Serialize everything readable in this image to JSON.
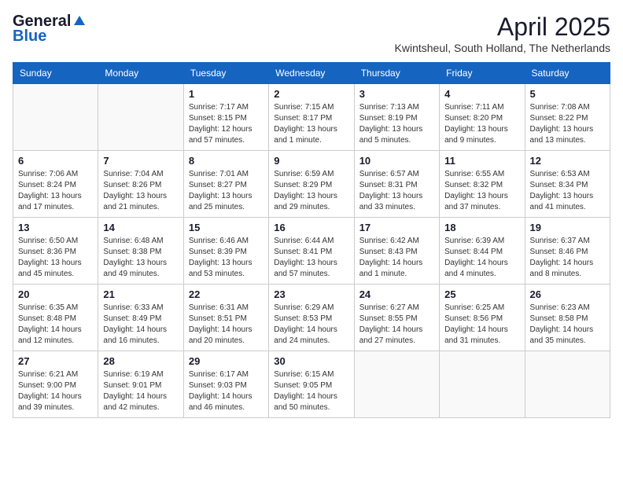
{
  "logo": {
    "general": "General",
    "blue": "Blue"
  },
  "title": "April 2025",
  "subtitle": "Kwintsheul, South Holland, The Netherlands",
  "days_of_week": [
    "Sunday",
    "Monday",
    "Tuesday",
    "Wednesday",
    "Thursday",
    "Friday",
    "Saturday"
  ],
  "weeks": [
    [
      {
        "day": "",
        "info": ""
      },
      {
        "day": "",
        "info": ""
      },
      {
        "day": "1",
        "info": "Sunrise: 7:17 AM\nSunset: 8:15 PM\nDaylight: 12 hours and 57 minutes."
      },
      {
        "day": "2",
        "info": "Sunrise: 7:15 AM\nSunset: 8:17 PM\nDaylight: 13 hours and 1 minute."
      },
      {
        "day": "3",
        "info": "Sunrise: 7:13 AM\nSunset: 8:19 PM\nDaylight: 13 hours and 5 minutes."
      },
      {
        "day": "4",
        "info": "Sunrise: 7:11 AM\nSunset: 8:20 PM\nDaylight: 13 hours and 9 minutes."
      },
      {
        "day": "5",
        "info": "Sunrise: 7:08 AM\nSunset: 8:22 PM\nDaylight: 13 hours and 13 minutes."
      }
    ],
    [
      {
        "day": "6",
        "info": "Sunrise: 7:06 AM\nSunset: 8:24 PM\nDaylight: 13 hours and 17 minutes."
      },
      {
        "day": "7",
        "info": "Sunrise: 7:04 AM\nSunset: 8:26 PM\nDaylight: 13 hours and 21 minutes."
      },
      {
        "day": "8",
        "info": "Sunrise: 7:01 AM\nSunset: 8:27 PM\nDaylight: 13 hours and 25 minutes."
      },
      {
        "day": "9",
        "info": "Sunrise: 6:59 AM\nSunset: 8:29 PM\nDaylight: 13 hours and 29 minutes."
      },
      {
        "day": "10",
        "info": "Sunrise: 6:57 AM\nSunset: 8:31 PM\nDaylight: 13 hours and 33 minutes."
      },
      {
        "day": "11",
        "info": "Sunrise: 6:55 AM\nSunset: 8:32 PM\nDaylight: 13 hours and 37 minutes."
      },
      {
        "day": "12",
        "info": "Sunrise: 6:53 AM\nSunset: 8:34 PM\nDaylight: 13 hours and 41 minutes."
      }
    ],
    [
      {
        "day": "13",
        "info": "Sunrise: 6:50 AM\nSunset: 8:36 PM\nDaylight: 13 hours and 45 minutes."
      },
      {
        "day": "14",
        "info": "Sunrise: 6:48 AM\nSunset: 8:38 PM\nDaylight: 13 hours and 49 minutes."
      },
      {
        "day": "15",
        "info": "Sunrise: 6:46 AM\nSunset: 8:39 PM\nDaylight: 13 hours and 53 minutes."
      },
      {
        "day": "16",
        "info": "Sunrise: 6:44 AM\nSunset: 8:41 PM\nDaylight: 13 hours and 57 minutes."
      },
      {
        "day": "17",
        "info": "Sunrise: 6:42 AM\nSunset: 8:43 PM\nDaylight: 14 hours and 1 minute."
      },
      {
        "day": "18",
        "info": "Sunrise: 6:39 AM\nSunset: 8:44 PM\nDaylight: 14 hours and 4 minutes."
      },
      {
        "day": "19",
        "info": "Sunrise: 6:37 AM\nSunset: 8:46 PM\nDaylight: 14 hours and 8 minutes."
      }
    ],
    [
      {
        "day": "20",
        "info": "Sunrise: 6:35 AM\nSunset: 8:48 PM\nDaylight: 14 hours and 12 minutes."
      },
      {
        "day": "21",
        "info": "Sunrise: 6:33 AM\nSunset: 8:49 PM\nDaylight: 14 hours and 16 minutes."
      },
      {
        "day": "22",
        "info": "Sunrise: 6:31 AM\nSunset: 8:51 PM\nDaylight: 14 hours and 20 minutes."
      },
      {
        "day": "23",
        "info": "Sunrise: 6:29 AM\nSunset: 8:53 PM\nDaylight: 14 hours and 24 minutes."
      },
      {
        "day": "24",
        "info": "Sunrise: 6:27 AM\nSunset: 8:55 PM\nDaylight: 14 hours and 27 minutes."
      },
      {
        "day": "25",
        "info": "Sunrise: 6:25 AM\nSunset: 8:56 PM\nDaylight: 14 hours and 31 minutes."
      },
      {
        "day": "26",
        "info": "Sunrise: 6:23 AM\nSunset: 8:58 PM\nDaylight: 14 hours and 35 minutes."
      }
    ],
    [
      {
        "day": "27",
        "info": "Sunrise: 6:21 AM\nSunset: 9:00 PM\nDaylight: 14 hours and 39 minutes."
      },
      {
        "day": "28",
        "info": "Sunrise: 6:19 AM\nSunset: 9:01 PM\nDaylight: 14 hours and 42 minutes."
      },
      {
        "day": "29",
        "info": "Sunrise: 6:17 AM\nSunset: 9:03 PM\nDaylight: 14 hours and 46 minutes."
      },
      {
        "day": "30",
        "info": "Sunrise: 6:15 AM\nSunset: 9:05 PM\nDaylight: 14 hours and 50 minutes."
      },
      {
        "day": "",
        "info": ""
      },
      {
        "day": "",
        "info": ""
      },
      {
        "day": "",
        "info": ""
      }
    ]
  ]
}
